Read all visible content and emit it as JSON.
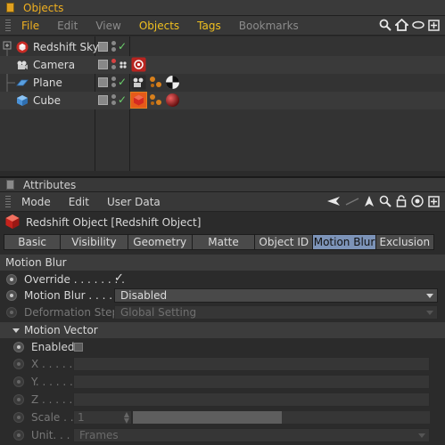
{
  "objects_panel": {
    "title": "Objects",
    "menu": [
      "File",
      "Edit",
      "View",
      "Objects",
      "Tags",
      "Bookmarks"
    ],
    "rows": [
      {
        "name": "Redshift Sky",
        "icon": "redshift-sky-icon"
      },
      {
        "name": "Camera",
        "icon": "camera-icon"
      },
      {
        "name": "Plane",
        "icon": "plane-icon"
      },
      {
        "name": "Cube",
        "icon": "cube-icon"
      }
    ]
  },
  "attributes_panel": {
    "title": "Attributes",
    "menu": [
      "Mode",
      "Edit",
      "User Data"
    ],
    "object_header": "Redshift Object [Redshift Object]",
    "tabs": [
      "Basic",
      "Visibility",
      "Geometry",
      "Matte",
      "Object ID",
      "Motion Blur",
      "Exclusion"
    ],
    "active_tab": "Motion Blur",
    "section_title": "Motion Blur",
    "params": {
      "override_label": "Override . . . . . . . .",
      "override_checked": "✓",
      "motion_blur_label": "Motion Blur . . . . .",
      "motion_blur_value": "Disabled",
      "deformation_label": "Deformation Steps",
      "deformation_value": "Global Setting"
    },
    "vector_section": "Motion Vector",
    "vector": {
      "enabled_label": "Enabled",
      "x_label": "X . . . . .",
      "y_label": "Y. . . . . .",
      "z_label": "Z . . . . . .",
      "scale_label": "Scale . .",
      "scale_value": "1",
      "scale_fill_fraction": 0.5,
      "unit_label": "Unit. . . .",
      "unit_value": "Frames"
    }
  },
  "colors": {
    "accent": "#f0b020",
    "active_tab": "#7c93b8",
    "check_green": "#6cd06c",
    "redshift_red": "#d9302a"
  }
}
